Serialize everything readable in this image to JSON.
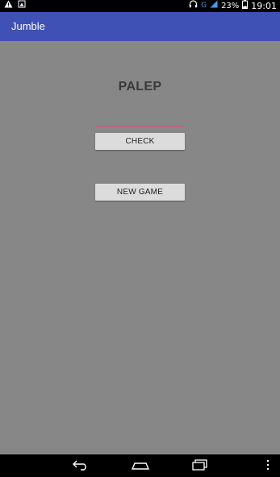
{
  "status_bar": {
    "network_label": "G",
    "battery_percent": "23%",
    "time": "19:01",
    "icons": [
      "warning-icon",
      "notification-icon",
      "headphones-icon",
      "signal-icon",
      "battery-icon"
    ]
  },
  "app_bar": {
    "title": "Jumble",
    "color": "#3f51b5"
  },
  "game": {
    "jumbled_word": "PALEP",
    "answer_value": "",
    "answer_placeholder": "",
    "input_underline_color": "#e0486a",
    "check_label": "CHECK",
    "new_game_label": "NEW GAME"
  },
  "nav_bar": {
    "icons": [
      "back-icon",
      "home-icon",
      "recent-apps-icon",
      "overflow-menu-icon"
    ]
  },
  "colors": {
    "background": "#878787",
    "button_bg": "#dcdcdc"
  }
}
